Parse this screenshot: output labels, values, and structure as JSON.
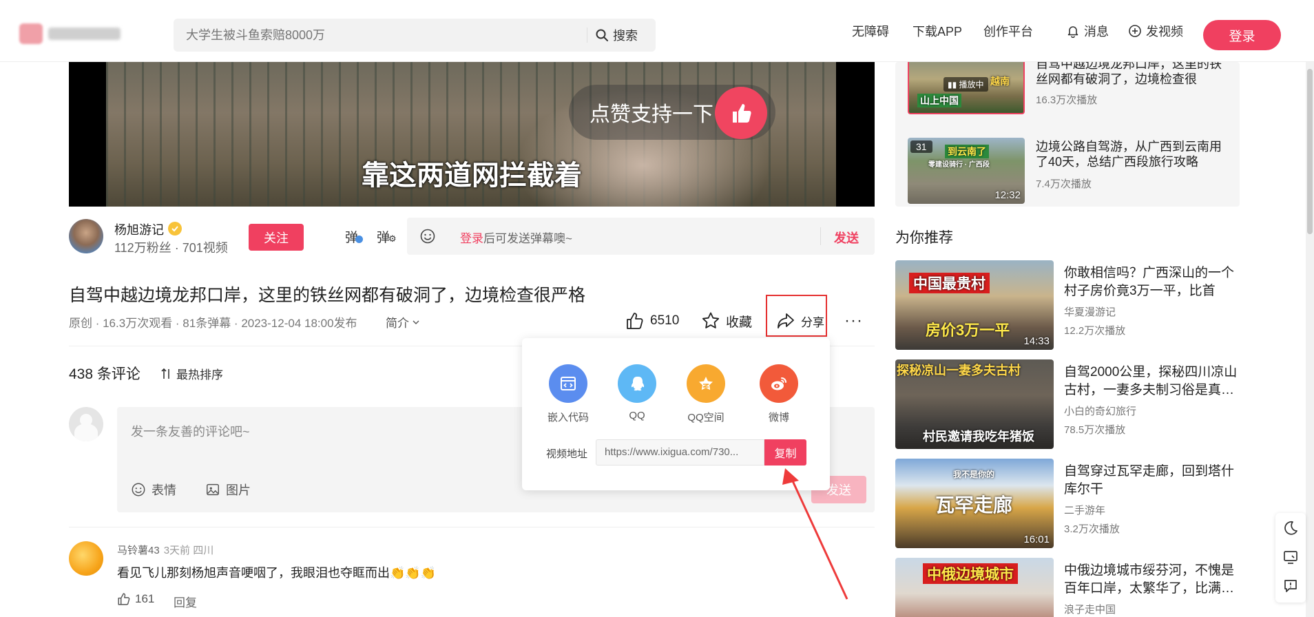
{
  "header": {
    "search_placeholder": "大学生被斗鱼索赔8000万",
    "search_button": "搜索",
    "nav": {
      "accessibility": "无障碍",
      "download": "下载APP",
      "creator": "创作平台",
      "messages": "消息",
      "upload": "发视频"
    },
    "login": "登录"
  },
  "video": {
    "overlay_like_text": "点赞支持一下",
    "subtitle": "靠这两道网拦截着"
  },
  "author": {
    "name": "杨旭游记",
    "stats": "112万粉丝 · 701视频",
    "follow_label": "关注",
    "danmu_toggle": "弹",
    "danmu_settings": "弹"
  },
  "danmu_input": {
    "login_link": "登录",
    "rest": "后可发送弹幕噢~",
    "send": "发送"
  },
  "video_info": {
    "title": "自驾中越边境龙邦口岸，这里的铁丝网都有破洞了，边境检查很严格",
    "meta": "原创 · 16.3万次观看 · 81条弹幕 · 2023-12-04 18:00发布",
    "intro": "简介",
    "likes": "6510",
    "favorite": "收藏",
    "share": "分享",
    "more": "···"
  },
  "share_popup": {
    "items": [
      {
        "label": "嵌入代码",
        "color": "#5b8def"
      },
      {
        "label": "QQ",
        "color": "#5eb8f5"
      },
      {
        "label": "QQ空间",
        "color": "#f8a930"
      },
      {
        "label": "微博",
        "color": "#f25a3a"
      }
    ],
    "url_label": "视频地址",
    "url": "https://www.ixigua.com/730...",
    "copy": "复制"
  },
  "comments": {
    "count": "438 条评论",
    "sort": "最热排序",
    "placeholder": "发一条友善的评论吧~",
    "emoji": "表情",
    "image": "图片",
    "send": "发送",
    "items": [
      {
        "user": "马铃薯43",
        "time_loc": "3天前 四川",
        "text": "看见飞儿那刻杨旭声音哽咽了，我眼泪也夺眶而出👏👏👏",
        "likes": "161",
        "reply": "回复"
      }
    ]
  },
  "playlist": [
    {
      "title": "自驾中越边境龙邦口岸，这里的铁丝网都有破洞了，边境检查很",
      "views": "16.3万次播放",
      "badge": "播放中",
      "caption": "山上中国",
      "caption2": "越南"
    },
    {
      "title": "边境公路自驾游，从广西到云南用了40天，总结广西段旅行攻略",
      "views": "7.4万次播放",
      "badge": "31",
      "caption": "到云南了",
      "caption2": "零建设骑行 · 广西段",
      "duration": "12:32"
    }
  ],
  "recommend": {
    "heading": "为你推荐",
    "items": [
      {
        "title": "你敢相信吗？广西深山的一个村子房价竟3万一平，比首府…",
        "author": "华夏漫游记",
        "views": "12.2万次播放",
        "duration": "14:33",
        "cap_top": "中国最贵村",
        "cap_bottom": "房价3万一平"
      },
      {
        "title": "自驾2000公里，探秘四川凉山古村，一妻多夫制习俗是真…",
        "author": "小白的奇幻旅行",
        "views": "78.5万次播放",
        "cap_top": "探秘凉山一妻多夫古村",
        "cap_bottom": "村民邀请我吃年猪饭"
      },
      {
        "title": "自驾穿过瓦罕走廊，回到塔什库尔干",
        "author": "二手游年",
        "views": "3.2万次播放",
        "duration": "16:01",
        "cap_top": "我不是你的",
        "cap_bottom": "瓦罕走廊"
      },
      {
        "title": "中俄边境城市绥芬河，不愧是百年口岸，太繁华了，比满…",
        "author": "浪子走中国",
        "views": "",
        "cap_top": "中俄边境城市"
      }
    ]
  }
}
